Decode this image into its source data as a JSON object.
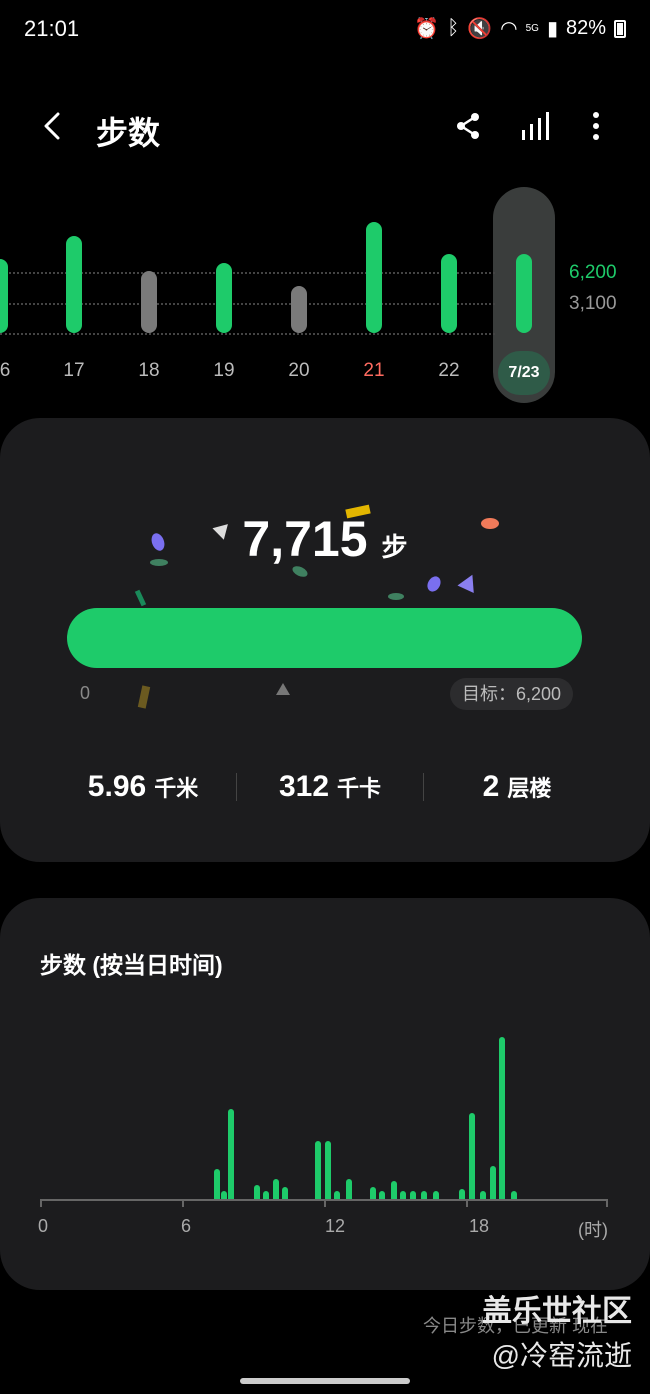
{
  "status": {
    "time": "21:01",
    "battery": "82%",
    "network": "5G"
  },
  "header": {
    "title": "步数"
  },
  "week": {
    "days": [
      "6",
      "17",
      "18",
      "19",
      "20",
      "21",
      "22"
    ],
    "selected": "7/23",
    "levels": [
      "6,200",
      "3,100"
    ],
    "values": [
      5500,
      7800,
      4300,
      5100,
      2700,
      9300,
      6000,
      6000
    ],
    "goal_color": "#1ecb6a",
    "below_color": "#7a7a7a"
  },
  "today": {
    "steps": "7,715",
    "steps_unit": "步",
    "progress_fraction": 1.0,
    "start_label": "0",
    "goal_label": "目标：6,200",
    "stats": [
      {
        "value": "5.96",
        "unit": "千米"
      },
      {
        "value": "312",
        "unit": "千卡"
      },
      {
        "value": "2",
        "unit": "层楼"
      }
    ]
  },
  "hourly": {
    "title": "步数 (按当日时间)",
    "x_labels": [
      "0",
      "6",
      "12",
      "18",
      "(时)"
    ],
    "chart_data": {
      "type": "bar",
      "xlabel": "(时)",
      "x": [
        7.5,
        7.8,
        8.1,
        9.2,
        9.6,
        10.0,
        10.4,
        11.8,
        12.2,
        12.6,
        13.1,
        14.1,
        14.5,
        15.0,
        15.4,
        15.8,
        16.3,
        16.8,
        17.9,
        18.3,
        18.8,
        19.2,
        19.6,
        20.1
      ],
      "values": [
        30,
        8,
        90,
        14,
        8,
        20,
        12,
        58,
        58,
        8,
        20,
        12,
        8,
        18,
        8,
        8,
        8,
        8,
        10,
        86,
        8,
        33,
        162,
        8
      ]
    }
  },
  "footer": {
    "note": "今日步数，已更新 现在"
  },
  "watermark": {
    "line1": "盖乐世社区",
    "line2": "@冷窑流逝"
  }
}
